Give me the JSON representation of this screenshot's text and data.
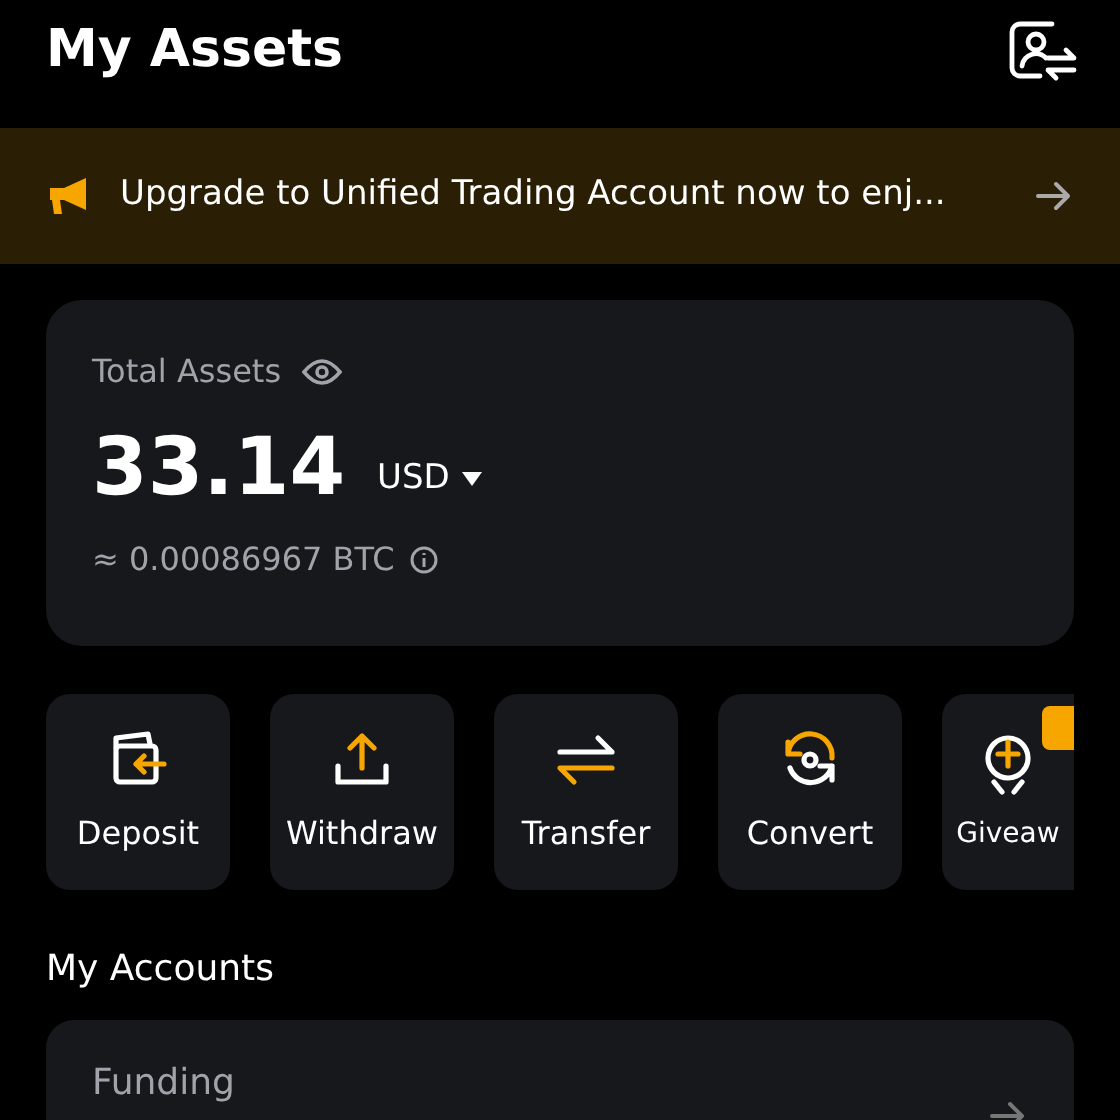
{
  "header": {
    "title": "My Assets"
  },
  "banner": {
    "text": "Upgrade to Unified Trading Account now to enj..."
  },
  "total": {
    "label": "Total Assets",
    "amount": "33.14",
    "currency": "USD",
    "btc": "≈ 0.00086967 BTC"
  },
  "actions": [
    {
      "kind": "deposit",
      "label": "Deposit"
    },
    {
      "kind": "withdraw",
      "label": "Withdraw"
    },
    {
      "kind": "transfer",
      "label": "Transfer"
    },
    {
      "kind": "convert",
      "label": "Convert"
    },
    {
      "kind": "giveaway",
      "label": "Giveaw",
      "badge": true
    }
  ],
  "accounts": {
    "title": "My Accounts",
    "items": [
      {
        "name": "Funding"
      }
    ]
  }
}
